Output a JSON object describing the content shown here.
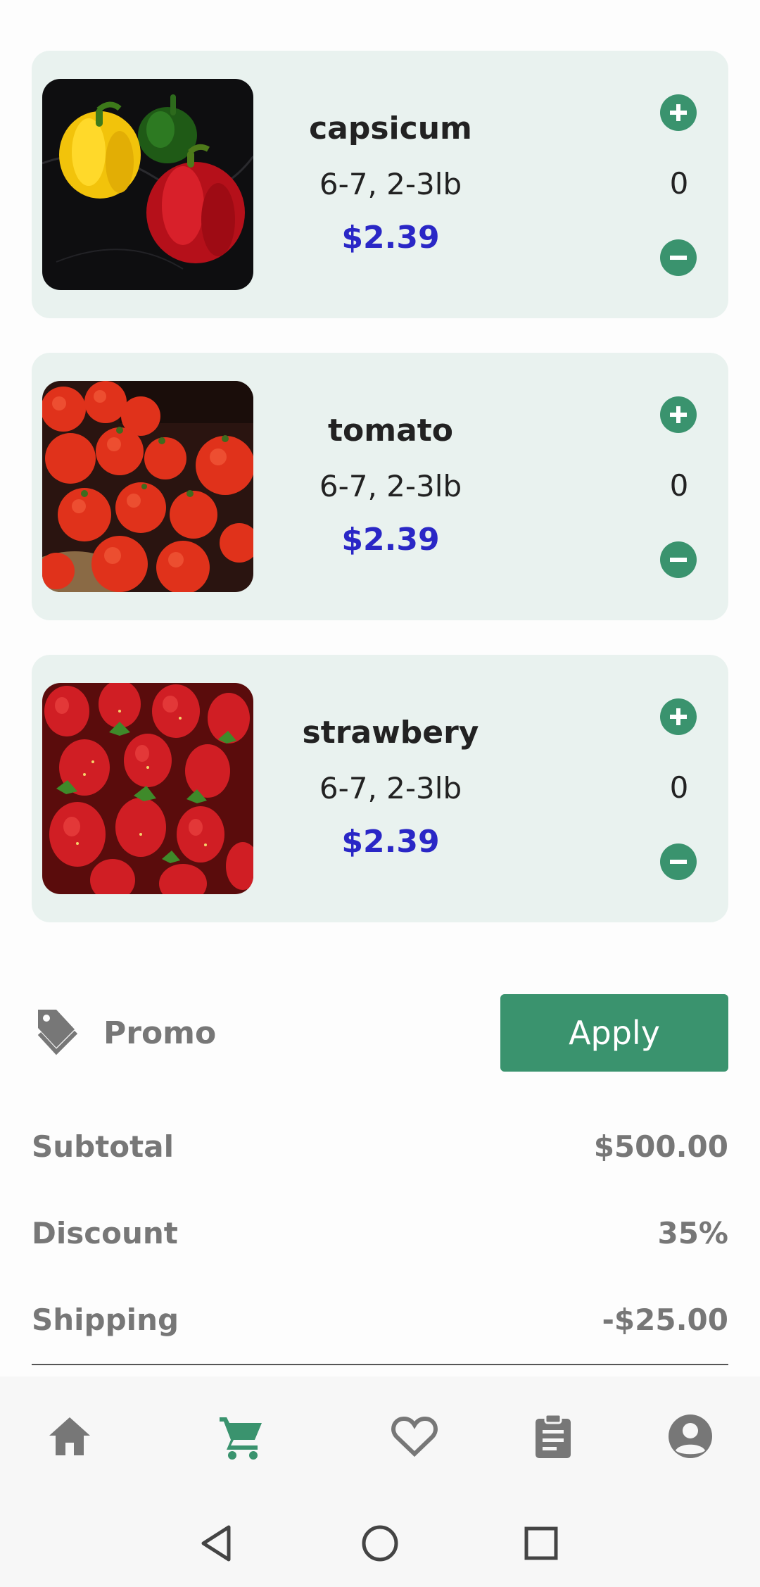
{
  "colors": {
    "accent_green": "#3a936e",
    "card_background": "#e9f2ef",
    "price_blue": "#2a27c6",
    "muted_text": "#777777"
  },
  "cart": {
    "items": [
      {
        "name": "capsicum",
        "size": "6-7, 2-3lb",
        "price": "$2.39",
        "quantity": "0",
        "image": "bell-peppers-photo"
      },
      {
        "name": "tomato",
        "size": "6-7, 2-3lb",
        "price": "$2.39",
        "quantity": "0",
        "image": "tomatoes-photo"
      },
      {
        "name": "strawbery",
        "size": "6-7, 2-3lb",
        "price": "$2.39",
        "quantity": "0",
        "image": "strawberries-photo"
      }
    ]
  },
  "promo": {
    "icon": "tag-icon",
    "label": "Promo",
    "apply_label": "Apply"
  },
  "summary": {
    "subtotal_label": "Subtotal",
    "subtotal_value": "$500.00",
    "discount_label": "Discount",
    "discount_value": "35%",
    "shipping_label": "Shipping",
    "shipping_value": "-$25.00"
  },
  "bottom_nav": {
    "items": [
      {
        "icon": "home-icon",
        "active": false
      },
      {
        "icon": "cart-icon",
        "active": true
      },
      {
        "icon": "heart-icon",
        "active": false
      },
      {
        "icon": "clipboard-icon",
        "active": false
      },
      {
        "icon": "account-icon",
        "active": false
      }
    ]
  },
  "system_nav": {
    "items": [
      "back-icon",
      "home-circle-icon",
      "recents-icon"
    ]
  }
}
